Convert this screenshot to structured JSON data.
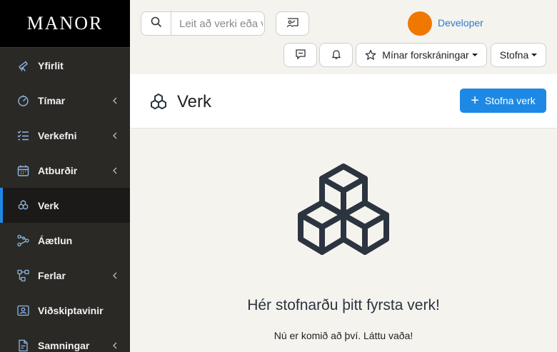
{
  "sidebar": {
    "logo": "MANOR",
    "items": [
      {
        "label": "Yfirlit",
        "icon": "telescope-icon",
        "has_submenu": false
      },
      {
        "label": "Tímar",
        "icon": "timer-icon",
        "has_submenu": true
      },
      {
        "label": "Verkefni",
        "icon": "task-list-icon",
        "has_submenu": true
      },
      {
        "label": "Atburðir",
        "icon": "calendar-icon",
        "has_submenu": true
      },
      {
        "label": "Verk",
        "icon": "cubes-icon",
        "has_submenu": false,
        "active": true
      },
      {
        "label": "Áætlun",
        "icon": "network-icon",
        "has_submenu": false
      },
      {
        "label": "Ferlar",
        "icon": "flow-icon",
        "has_submenu": true
      },
      {
        "label": "Viðskiptavinir",
        "icon": "contacts-icon",
        "has_submenu": false
      },
      {
        "label": "Samningar",
        "icon": "contract-icon",
        "has_submenu": true
      }
    ]
  },
  "topbar": {
    "search_placeholder": "Leit að verki eða verkefni",
    "search_icon": "search-icon",
    "presentation_icon": "presentation-icon",
    "user_name": "Developer",
    "avatar_color": "#f07800",
    "chat_icon": "chat-icon",
    "bell_icon": "bell-icon",
    "favorites_label": "Mínar forskráningar",
    "create_label": "Stofna"
  },
  "header": {
    "title": "Verk",
    "title_icon": "cubes-icon",
    "new_button_label": "Stofna verk"
  },
  "empty_state": {
    "illustration": "cubes-icon",
    "title": "Hér stofnarðu þitt fyrsta verk!",
    "subtitle": "Nú er komið að því. Láttu vaða!"
  },
  "colors": {
    "accent": "#1e88e5",
    "sidebar_bg": "#2a2926",
    "link": "#2b7bd3"
  }
}
